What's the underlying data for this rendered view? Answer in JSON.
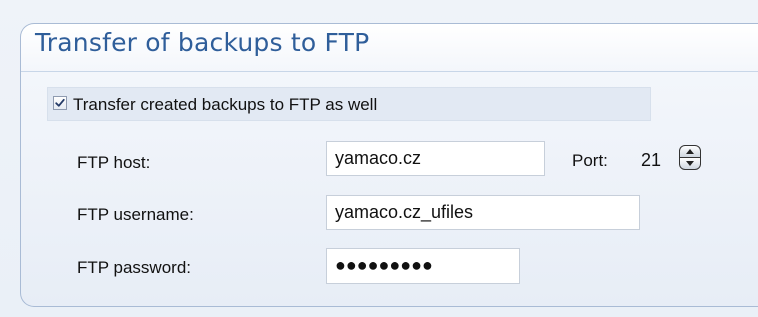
{
  "group": {
    "title": "Transfer of backups to FTP"
  },
  "transfer_option": {
    "label": "Transfer created backups to FTP as well",
    "checked": true
  },
  "ftp": {
    "host_label": "FTP host:",
    "host_value": "yamaco.cz",
    "port_label": "Port:",
    "port_value": "21",
    "username_label": "FTP username:",
    "username_value": "yamaco.cz_ufiles",
    "password_label": "FTP password:",
    "password_masked": "●●●●●●●●●"
  },
  "colors": {
    "title": "#2f5e9a",
    "panel_border": "#a9bbd5",
    "checkbox_row_bg": "#e2e9f3",
    "input_border": "#c7cfda"
  },
  "icons": {
    "checkbox": "checkmark-icon",
    "spinner_up": "triangle-up-icon",
    "spinner_down": "triangle-down-icon"
  }
}
